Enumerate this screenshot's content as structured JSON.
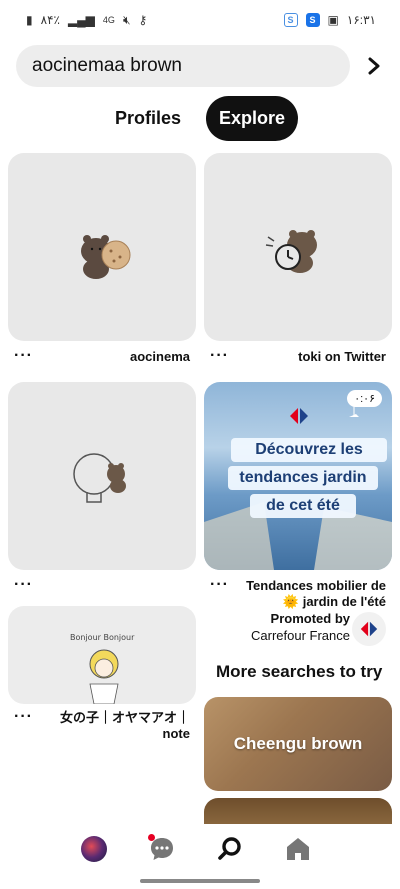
{
  "status_bar": {
    "battery": "٨۴٪",
    "signal_label": "4G",
    "time": "۱۶:۳۱"
  },
  "search": {
    "query": "aocinemaa brown"
  },
  "tabs": [
    {
      "label": "Profiles",
      "active": false
    },
    {
      "label": "Explore",
      "active": true
    }
  ],
  "pins": [
    {
      "source": "aocinema"
    },
    {
      "source": "toki on Twitter"
    },
    {
      "source": ""
    },
    {
      "ad_text": [
        "Découvrez les",
        "tendances jardin",
        "de cet été"
      ],
      "timer": "۰:۰۶",
      "title": "Tendances mobilier de 🌞 jardin de l'été",
      "promoted_label": "Promoted by",
      "advertiser": "Carrefour France"
    },
    {
      "source": "女の子｜オヤマアオ｜ note"
    }
  ],
  "more_searches": {
    "title": "More searches to try",
    "items": [
      "Cheengu brown"
    ]
  },
  "colors": {
    "accent": "#e60023",
    "tab_active_bg": "#111111",
    "search_bg": "#ededed"
  }
}
